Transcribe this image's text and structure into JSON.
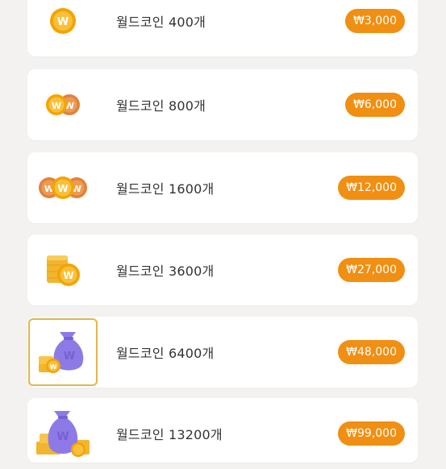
{
  "items": [
    {
      "label": "월드코인 400개",
      "price": "₩3,000",
      "icon": "coin-icon"
    },
    {
      "label": "월드코인 800개",
      "price": "₩6,000",
      "icon": "two-coins-icon"
    },
    {
      "label": "월드코인 1600개",
      "price": "₩12,000",
      "icon": "three-coins-icon"
    },
    {
      "label": "월드코인 3600개",
      "price": "₩27,000",
      "icon": "coin-stack-icon"
    },
    {
      "label": "월드코인 6400개",
      "price": "₩48,000",
      "icon": "money-bag-icon"
    },
    {
      "label": "월드코인 13200개",
      "price": "₩99,000",
      "icon": "large-money-bag-icon"
    }
  ],
  "coin_glyph": "W",
  "colors": {
    "accent": "#f08f12",
    "coin": "#f5a300",
    "coin_inner": "#f9c03b",
    "bag": "#8d7ae6",
    "selected_border": "#e3b64a"
  }
}
